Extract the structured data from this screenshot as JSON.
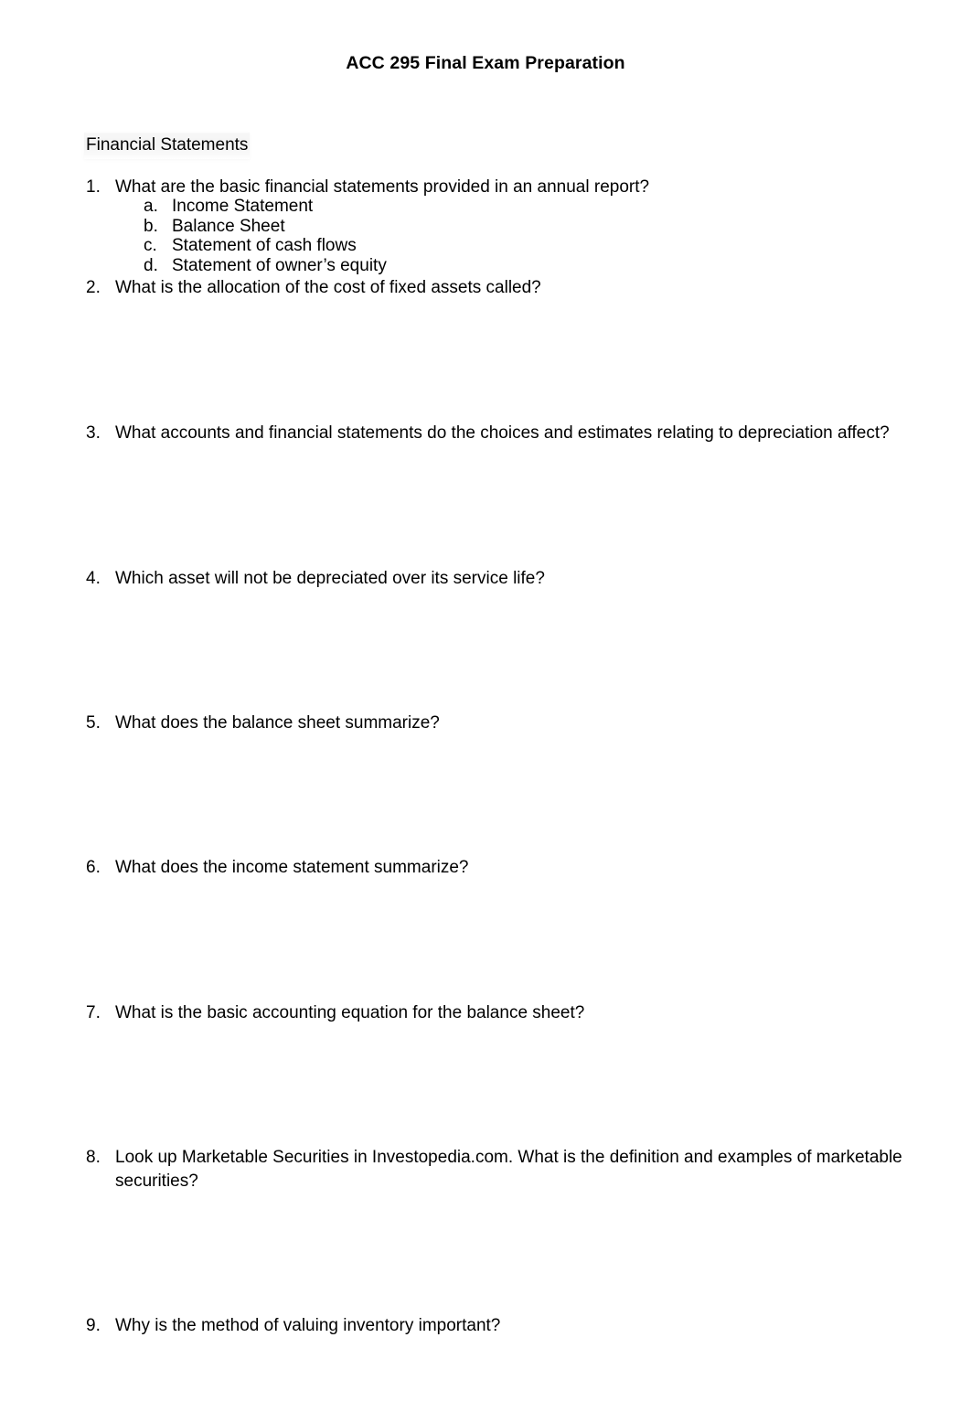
{
  "document": {
    "title": "ACC 295 Final Exam Preparation",
    "section_heading": "Financial Statements",
    "highlight_color": "#f3f3f3",
    "text_color": "#000000",
    "background_color": "#ffffff"
  },
  "questions": [
    {
      "number": "1.",
      "text": "What are the basic financial statements provided in an annual report?",
      "subitems": [
        {
          "letter": "a.",
          "text": "Income Statement"
        },
        {
          "letter": "b.",
          "text": "Balance Sheet"
        },
        {
          "letter": "c.",
          "text": "Statement of cash flows"
        },
        {
          "letter": "d.",
          "text": "Statement of owner’s equity"
        }
      ]
    },
    {
      "number": "2.",
      "text": "What is the allocation of the cost of fixed assets called?"
    },
    {
      "number": "3.",
      "text": "What accounts and financial statements do the choices and estimates relating to depreciation affect?"
    },
    {
      "number": "4.",
      "text": "Which asset will not be depreciated over its service life?"
    },
    {
      "number": "5.",
      "text": "What does the balance sheet summarize?"
    },
    {
      "number": "6.",
      "text": "What does the income statement summarize?"
    },
    {
      "number": "7.",
      "text": "What is the basic accounting equation for the balance sheet?"
    },
    {
      "number": "8.",
      "text": "Look up Marketable Securities in Investopedia.com.  What is the definition and examples of marketable securities?"
    },
    {
      "number": "9.",
      "text": "Why is the method of valuing inventory important?"
    }
  ]
}
